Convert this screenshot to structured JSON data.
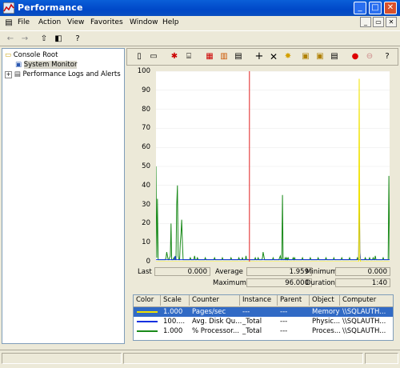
{
  "window": {
    "title": "Performance"
  },
  "menu": [
    "File",
    "Action",
    "View",
    "Favorites",
    "Window",
    "Help"
  ],
  "tree": {
    "root": "Console Root",
    "items": [
      "System Monitor",
      "Performance Logs and Alerts"
    ]
  },
  "graph": {
    "yticks": [
      "100",
      "90",
      "80",
      "70",
      "60",
      "50",
      "40",
      "30",
      "20",
      "10",
      "0"
    ],
    "ylim": [
      0,
      100
    ]
  },
  "stats": {
    "last_label": "Last",
    "last_value": "0.000",
    "average_label": "Average",
    "average_value": "1.959",
    "minimum_label": "Minimum",
    "minimum_value": "0.000",
    "maximum_label": "Maximum",
    "maximum_value": "96.000",
    "duration_label": "Duration",
    "duration_value": "1:40"
  },
  "counters": {
    "headers": [
      "Color",
      "Scale",
      "Counter",
      "Instance",
      "Parent",
      "Object",
      "Computer"
    ],
    "rows": [
      {
        "color": "#f0e200",
        "scale": "1.000",
        "counter": "Pages/sec",
        "instance": "---",
        "parent": "---",
        "object": "Memory",
        "computer": "\\\\SQLAUTH..."
      },
      {
        "color": "#1030e0",
        "scale": "100....",
        "counter": "Avg. Disk Qu...",
        "instance": "_Total",
        "parent": "---",
        "object": "Physic...",
        "computer": "\\\\SQLAUTH..."
      },
      {
        "color": "#1a8a1a",
        "scale": "1.000",
        "counter": "% Processor...",
        "instance": "_Total",
        "parent": "---",
        "object": "Proces...",
        "computer": "\\\\SQLAUTH..."
      }
    ]
  },
  "chart_data": {
    "type": "line",
    "ylim": [
      0,
      100
    ],
    "series": [
      {
        "color": "#1a8a1a",
        "values": [
          50,
          2,
          33,
          1,
          1,
          1,
          1,
          1,
          1,
          1,
          1,
          1,
          1,
          1,
          2,
          5,
          3,
          1,
          1,
          2,
          3,
          20,
          1,
          1,
          1,
          2,
          1,
          1,
          1,
          30,
          40,
          3,
          1,
          1,
          10,
          15,
          22,
          10,
          1,
          1,
          1,
          1,
          1,
          1,
          1,
          1,
          1,
          1,
          2,
          1,
          1,
          1,
          1,
          1,
          3,
          1,
          1,
          1,
          2,
          1,
          1,
          1,
          1,
          1,
          1,
          1,
          1,
          1,
          1,
          2,
          1,
          1,
          1,
          1,
          1,
          1,
          1,
          1,
          1,
          1,
          1,
          1,
          2,
          1,
          1,
          1,
          1,
          1,
          1,
          1,
          1,
          1,
          1,
          2,
          1,
          1,
          1,
          1,
          1,
          1,
          1,
          1,
          1,
          1,
          1,
          2,
          1,
          1,
          1,
          1,
          1,
          1,
          1,
          1,
          1,
          1,
          2,
          1,
          1,
          1,
          1,
          2,
          1,
          1,
          1,
          1,
          3,
          1,
          1,
          1,
          1,
          1,
          1,
          1,
          1,
          1,
          1,
          1,
          1,
          2,
          1,
          1,
          1,
          2,
          1,
          1,
          1,
          1,
          1,
          2,
          5,
          3,
          1,
          1,
          1,
          1,
          1,
          1,
          1,
          1,
          1,
          1,
          1,
          1,
          2,
          1,
          1,
          1,
          1,
          1,
          1,
          1,
          1,
          2,
          3,
          1,
          1,
          35,
          1,
          1,
          1,
          2,
          1,
          2,
          1,
          2,
          1,
          1,
          1,
          1,
          1,
          1,
          2,
          1,
          2,
          1,
          1,
          1,
          1,
          1,
          1,
          1,
          1,
          1,
          1,
          2,
          1,
          1,
          1,
          1,
          1,
          1,
          1,
          1,
          1,
          1,
          2,
          1,
          1,
          1,
          1,
          1,
          1,
          1,
          1,
          1,
          1,
          2,
          1,
          1,
          1,
          1,
          1,
          1,
          1,
          1,
          1,
          1,
          2,
          1,
          1,
          1,
          1,
          1,
          1,
          1,
          1,
          1,
          1,
          2,
          1,
          1,
          1,
          1,
          1,
          1,
          1,
          1,
          1,
          1,
          2,
          1,
          1,
          1,
          1,
          1,
          1,
          1,
          1,
          1,
          1,
          2,
          1,
          1,
          1,
          1,
          1,
          1,
          1,
          1,
          1,
          1,
          2,
          1,
          1,
          1,
          1,
          1,
          1,
          1,
          1,
          1,
          1,
          2,
          1,
          1,
          1,
          1,
          1,
          2,
          1,
          1,
          1,
          1,
          2,
          1,
          1,
          3,
          1,
          1,
          1,
          1,
          1,
          1,
          1,
          1,
          1,
          1,
          2,
          1,
          1,
          1,
          1,
          1,
          1,
          1,
          45,
          1
        ]
      },
      {
        "color": "#1030e0",
        "values": [
          1,
          1,
          1,
          1,
          1,
          1,
          1,
          1,
          1,
          1,
          1,
          1,
          1,
          1,
          1,
          1,
          1,
          1,
          1,
          1,
          1,
          1,
          1,
          1,
          1,
          1,
          1,
          1,
          1,
          3,
          1,
          1,
          1,
          1,
          1,
          1,
          1,
          1,
          1,
          1,
          1,
          1,
          1,
          1,
          1,
          1,
          1,
          1,
          1,
          1,
          1,
          1,
          1,
          1,
          1,
          1,
          1,
          1,
          1,
          1,
          1,
          1,
          1,
          1,
          1,
          1,
          1,
          1,
          1,
          1,
          1,
          1,
          1,
          1,
          1,
          1,
          1,
          1,
          1,
          1,
          1,
          1,
          1,
          1,
          1,
          1,
          1,
          1,
          1,
          1,
          1,
          1,
          1,
          1,
          1,
          1,
          1,
          1,
          1,
          1,
          1,
          1,
          1,
          1,
          1,
          1,
          1,
          1,
          1,
          1,
          1,
          1,
          1,
          1,
          1,
          1,
          1,
          1,
          1,
          1,
          1,
          1,
          1,
          1,
          1,
          1,
          1,
          1,
          1,
          1,
          1,
          1,
          1,
          1,
          1,
          1,
          1,
          1,
          1,
          1,
          1,
          1,
          1,
          1,
          1,
          1,
          1,
          1,
          1,
          1,
          1,
          1,
          1,
          1,
          1,
          1,
          1,
          1,
          1,
          1,
          1,
          1,
          1,
          1,
          1,
          1,
          1,
          1,
          1,
          1,
          1,
          1,
          1,
          1,
          1,
          1,
          1,
          1,
          1,
          1,
          1,
          1,
          1,
          1,
          1,
          1,
          1,
          1,
          1,
          1,
          1,
          1,
          1,
          1,
          1,
          1,
          1,
          1,
          1,
          1,
          1,
          1,
          1,
          1,
          1,
          1,
          1,
          1,
          1,
          1,
          1,
          1,
          1,
          1,
          1,
          1,
          1,
          1,
          1,
          1,
          1,
          1,
          1,
          1,
          1,
          1,
          1,
          1,
          1,
          1,
          1,
          1,
          1,
          1,
          1,
          1,
          1,
          1,
          1,
          1,
          1,
          1,
          1,
          1,
          1,
          1,
          1,
          1,
          1,
          1,
          1,
          1,
          1,
          1,
          1,
          1,
          1,
          1,
          1,
          1,
          1,
          1,
          1,
          1,
          1,
          1,
          1,
          1,
          1,
          1,
          1,
          1,
          1,
          1,
          1,
          1,
          1,
          1,
          1,
          1,
          1,
          1,
          1,
          1,
          1,
          1,
          1,
          1,
          1,
          1,
          1,
          1,
          1,
          1,
          1,
          1,
          1,
          1,
          1,
          1,
          1,
          1,
          1,
          1,
          1,
          1,
          1,
          1,
          33,
          5,
          1,
          1,
          1,
          1,
          1,
          1,
          1,
          1,
          1,
          1,
          1,
          1,
          1,
          1,
          1,
          1,
          1,
          1,
          1,
          1,
          1,
          1,
          1,
          1,
          1,
          1,
          1,
          1,
          1,
          1,
          1,
          1,
          1,
          1,
          1,
          1,
          1,
          1,
          1,
          1,
          1,
          1,
          1,
          1,
          1
        ]
      },
      {
        "color": "#f0e200",
        "values": [
          0,
          0,
          0,
          0,
          0,
          0,
          0,
          0,
          0,
          0,
          0,
          0,
          0,
          0,
          0,
          0,
          0,
          0,
          0,
          0,
          0,
          0,
          0,
          0,
          0,
          0,
          0,
          0,
          0,
          0,
          0,
          0,
          0,
          0,
          0,
          0,
          0,
          0,
          0,
          0,
          0,
          0,
          0,
          0,
          0,
          0,
          0,
          0,
          0,
          0,
          0,
          0,
          0,
          0,
          0,
          0,
          0,
          0,
          0,
          0,
          0,
          0,
          0,
          0,
          0,
          0,
          0,
          0,
          0,
          0,
          0,
          0,
          0,
          0,
          0,
          0,
          0,
          0,
          0,
          0,
          0,
          0,
          0,
          0,
          0,
          0,
          0,
          0,
          0,
          0,
          0,
          0,
          0,
          0,
          0,
          0,
          0,
          0,
          0,
          0,
          0,
          0,
          0,
          0,
          0,
          0,
          0,
          0,
          0,
          0,
          0,
          0,
          0,
          0,
          0,
          0,
          0,
          0,
          0,
          0,
          0,
          0,
          0,
          0,
          0,
          0,
          0,
          0,
          0,
          0,
          0,
          0,
          0,
          0,
          0,
          0,
          0,
          0,
          0,
          0,
          0,
          0,
          0,
          0,
          0,
          0,
          0,
          0,
          0,
          0,
          0,
          0,
          0,
          0,
          0,
          0,
          0,
          0,
          0,
          0,
          0,
          0,
          0,
          0,
          0,
          0,
          0,
          0,
          0,
          0,
          0,
          0,
          0,
          0,
          0,
          0,
          0,
          0,
          0,
          0,
          0,
          0,
          0,
          0,
          0,
          0,
          0,
          0,
          0,
          0,
          0,
          0,
          0,
          0,
          0,
          0,
          0,
          0,
          0,
          0,
          0,
          0,
          0,
          0,
          0,
          0,
          0,
          0,
          0,
          0,
          0,
          0,
          0,
          0,
          0,
          0,
          0,
          0,
          0,
          0,
          0,
          0,
          0,
          0,
          0,
          0,
          0,
          0,
          0,
          0,
          0,
          0,
          0,
          0,
          0,
          0,
          0,
          0,
          0,
          0,
          0,
          0,
          0,
          0,
          0,
          0,
          0,
          0,
          0,
          0,
          0,
          0,
          0,
          0,
          0,
          0,
          0,
          0,
          0,
          0,
          0,
          0,
          0,
          0,
          0,
          0,
          0,
          0,
          0,
          0,
          0,
          0,
          0,
          0,
          0,
          0,
          0,
          0,
          0,
          0,
          0,
          0,
          0,
          0,
          0,
          0,
          0,
          0,
          0,
          0,
          0,
          0,
          0,
          0,
          0,
          0,
          0,
          0,
          0,
          0,
          0,
          0,
          0,
          0,
          0,
          0,
          0,
          0,
          0,
          0,
          0,
          0,
          0,
          0,
          0,
          0,
          0,
          0,
          0,
          0,
          0,
          0,
          0,
          0,
          0,
          0,
          0,
          0,
          96,
          2,
          0,
          0,
          0,
          0,
          0,
          0,
          0,
          0,
          0,
          0,
          0,
          0,
          0,
          0,
          0,
          0,
          0,
          0,
          0,
          0,
          0,
          0,
          0,
          0,
          0,
          0,
          0,
          0,
          0,
          0,
          0,
          0,
          0,
          0,
          0,
          0,
          0,
          0,
          0,
          0,
          0,
          0,
          0,
          0,
          0,
          0,
          0,
          0
        ]
      }
    ],
    "time_bar_position": 0.4
  }
}
